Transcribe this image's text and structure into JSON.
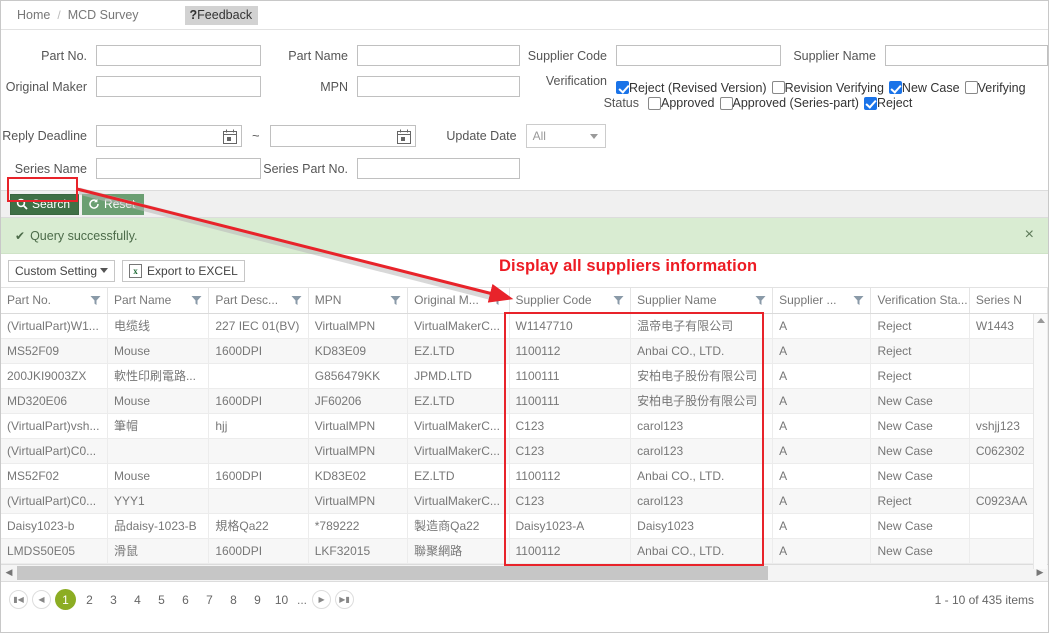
{
  "breadcrumb": {
    "home": "Home",
    "sep": "/",
    "current": "MCD Survey",
    "feedback_q": "?",
    "feedback_label": "Feedback"
  },
  "form": {
    "labels": {
      "part_no": "Part No.",
      "part_name": "Part Name",
      "supplier_code": "Supplier Code",
      "supplier_name": "Supplier Name",
      "original_maker": "Original Maker",
      "mpn": "MPN",
      "verification": "Verification",
      "status": "Status",
      "reply_deadline": "Reply Deadline",
      "update_date": "Update Date",
      "series_name": "Series Name",
      "series_part_no": "Series Part No."
    },
    "values": {
      "part_no": "",
      "part_name": "",
      "supplier_code": "",
      "supplier_name": "",
      "original_maker": "",
      "mpn": "",
      "reply_deadline_from": "",
      "reply_deadline_to": "",
      "series_name": "",
      "series_part_no": ""
    },
    "tilde": "~",
    "update_date_selected": "All",
    "verification_checkboxes": [
      {
        "label": "Reject (Revised Version)",
        "checked": true
      },
      {
        "label": "Revision Verifying",
        "checked": false
      },
      {
        "label": "New Case",
        "checked": true
      },
      {
        "label": "Verifying",
        "checked": false
      },
      {
        "label": "Approved",
        "checked": false
      },
      {
        "label": "Approved (Series-part)",
        "checked": false
      },
      {
        "label": "Reject",
        "checked": true
      }
    ]
  },
  "buttons": {
    "search": "Search",
    "reset": "Reset"
  },
  "message": {
    "text": "Query successfully.",
    "tick": "✔",
    "close": "×"
  },
  "gridtools": {
    "custom_setting": "Custom Setting",
    "export_excel": "Export to EXCEL",
    "excel_glyph": "x"
  },
  "annotation": {
    "text": "Display all suppliers information",
    "color": "#ed1c24"
  },
  "grid": {
    "columns": [
      {
        "label": "Part No.",
        "filter": true
      },
      {
        "label": "Part Name",
        "filter": true
      },
      {
        "label": "Part Desc...",
        "filter": true
      },
      {
        "label": "MPN",
        "filter": true
      },
      {
        "label": "Original M...",
        "filter": true
      },
      {
        "label": "Supplier Code",
        "filter": true
      },
      {
        "label": "Supplier Name",
        "filter": true
      },
      {
        "label": "Supplier ...",
        "filter": true
      },
      {
        "label": "Verification Sta...",
        "filter": false
      },
      {
        "label": "Series N",
        "filter": false
      }
    ],
    "rows": [
      {
        "part_no": "(VirtualPart)W1...",
        "part_name": "电缆线",
        "part_desc": "227 IEC 01(BV)",
        "mpn": "VirtualMPN",
        "original_maker": "VirtualMakerC...",
        "supplier_code": "W1147710",
        "supplier_name": "温帝电子有限公司",
        "supplier_x": "A",
        "verification_status": "Reject",
        "series_name": "W1443"
      },
      {
        "part_no": "MS52F09",
        "part_name": "Mouse",
        "part_desc": "1600DPI",
        "mpn": "KD83E09",
        "original_maker": "EZ.LTD",
        "supplier_code": "1100112",
        "supplier_name": "Anbai CO., LTD.",
        "supplier_x": "A",
        "verification_status": "Reject",
        "series_name": ""
      },
      {
        "part_no": "200JKI9003ZX",
        "part_name": "軟性印刷電路...",
        "part_desc": "",
        "mpn": "G856479KK",
        "original_maker": "JPMD.LTD",
        "supplier_code": "1100111",
        "supplier_name": "安柏电子股份有限公司",
        "supplier_x": "A",
        "verification_status": "Reject",
        "series_name": ""
      },
      {
        "part_no": "MD320E06",
        "part_name": "Mouse",
        "part_desc": "1600DPI",
        "mpn": "JF60206",
        "original_maker": "EZ.LTD",
        "supplier_code": "1100111",
        "supplier_name": "安柏电子股份有限公司",
        "supplier_x": "A",
        "verification_status": "New Case",
        "series_name": ""
      },
      {
        "part_no": "(VirtualPart)vsh...",
        "part_name": "筆帽",
        "part_desc": "hjj",
        "mpn": "VirtualMPN",
        "original_maker": "VirtualMakerC...",
        "supplier_code": "C123",
        "supplier_name": "carol123",
        "supplier_x": "A",
        "verification_status": "New Case",
        "series_name": "vshjj123"
      },
      {
        "part_no": "(VirtualPart)C0...",
        "part_name": "",
        "part_desc": "",
        "mpn": "VirtualMPN",
        "original_maker": "VirtualMakerC...",
        "supplier_code": "C123",
        "supplier_name": "carol123",
        "supplier_x": "A",
        "verification_status": "New Case",
        "series_name": "C062302"
      },
      {
        "part_no": "MS52F02",
        "part_name": "Mouse",
        "part_desc": "1600DPI",
        "mpn": "KD83E02",
        "original_maker": "EZ.LTD",
        "supplier_code": "1100112",
        "supplier_name": "Anbai CO., LTD.",
        "supplier_x": "A",
        "verification_status": "New Case",
        "series_name": ""
      },
      {
        "part_no": "(VirtualPart)C0...",
        "part_name": "YYY1",
        "part_desc": "",
        "mpn": "VirtualMPN",
        "original_maker": "VirtualMakerC...",
        "supplier_code": "C123",
        "supplier_name": "carol123",
        "supplier_x": "A",
        "verification_status": "Reject",
        "series_name": "C0923AA"
      },
      {
        "part_no": "Daisy1023-b",
        "part_name": "品daisy-1023-B",
        "part_desc": "規格Qa22",
        "mpn": "*789222",
        "original_maker": "製造商Qa22",
        "supplier_code": "Daisy1023-A",
        "supplier_name": "Daisy1023",
        "supplier_x": "A",
        "verification_status": "New Case",
        "series_name": ""
      },
      {
        "part_no": "LMDS50E05",
        "part_name": "滑鼠",
        "part_desc": "1600DPI",
        "mpn": "LKF32015",
        "original_maker": "聯聚網路",
        "supplier_code": "1100112",
        "supplier_name": "Anbai CO., LTD.",
        "supplier_x": "A",
        "verification_status": "New Case",
        "series_name": ""
      }
    ]
  },
  "pager": {
    "first": "⏮",
    "prev": "◀",
    "next": "▶",
    "last": "⏭",
    "pages": [
      "1",
      "2",
      "3",
      "4",
      "5",
      "6",
      "7",
      "8",
      "9",
      "10"
    ],
    "current": "1",
    "dots": "...",
    "info": "1 - 10 of 435 items"
  },
  "colors": {
    "accent_green": "#3f7046",
    "pager_current": "#8cad23",
    "annotation_red": "#ed1c24",
    "link_blue": "#3e7bbd",
    "checkbox_blue": "#1a73e8"
  }
}
